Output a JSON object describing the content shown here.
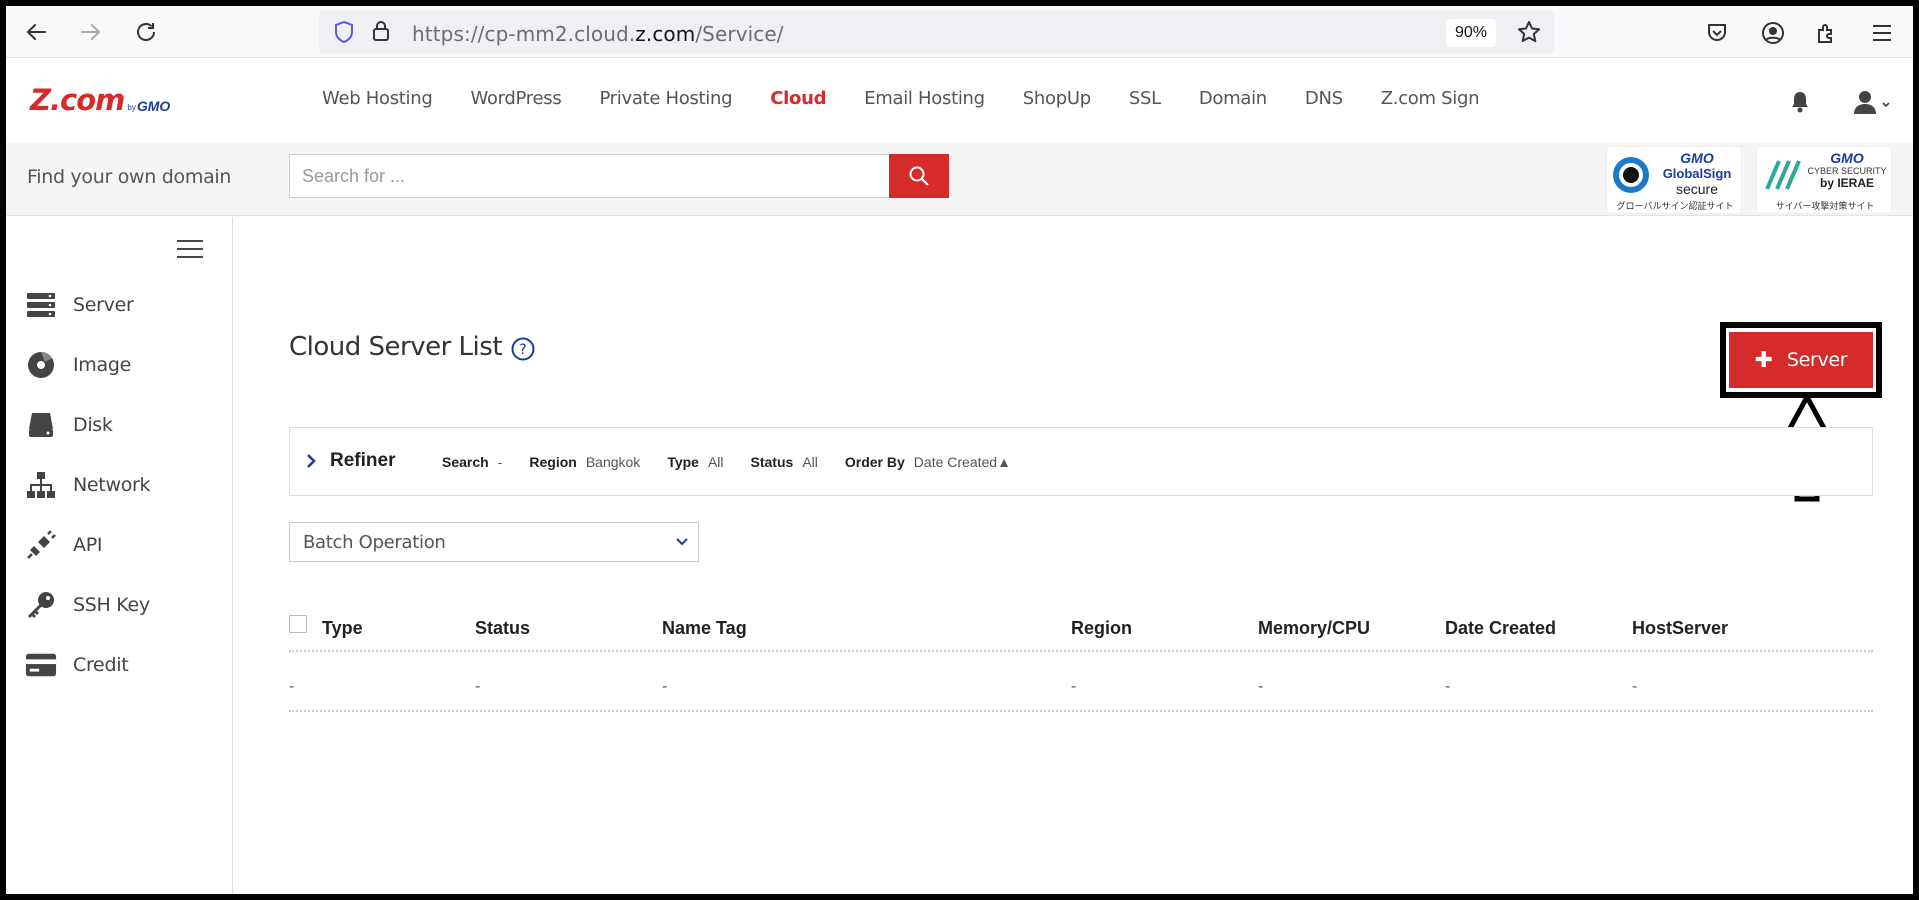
{
  "browser": {
    "url_prefix": "https://cp-mm2.cloud.",
    "url_host": "z.com",
    "url_path": "/Service/",
    "zoom": "90%"
  },
  "header": {
    "logo_text": "Z.com",
    "logo_by": "by",
    "logo_gmo": "GMO",
    "nav": [
      {
        "label": "Web Hosting"
      },
      {
        "label": "WordPress"
      },
      {
        "label": "Private Hosting"
      },
      {
        "label": "Cloud",
        "active": true
      },
      {
        "label": "Email Hosting"
      },
      {
        "label": "ShopUp"
      },
      {
        "label": "SSL"
      },
      {
        "label": "Domain"
      },
      {
        "label": "DNS"
      },
      {
        "label": "Z.com Sign"
      }
    ]
  },
  "domain_search": {
    "label": "Find your own domain",
    "placeholder": "Search for ..."
  },
  "badges": {
    "globalsign": {
      "l1": "GMO",
      "l2": "GlobalSign",
      "l3": "secure",
      "jp": "グローバルサイン認証サイト"
    },
    "ierae": {
      "l1": "GMO",
      "l2": "CYBER SECURITY",
      "l3": "by IERAE",
      "jp": "サイバー攻撃対策サイト"
    }
  },
  "sidebar": {
    "items": [
      {
        "label": "Server",
        "icon": "server-icon"
      },
      {
        "label": "Image",
        "icon": "disc-icon"
      },
      {
        "label": "Disk",
        "icon": "disk-icon"
      },
      {
        "label": "Network",
        "icon": "network-icon"
      },
      {
        "label": "API",
        "icon": "plug-icon"
      },
      {
        "label": "SSH Key",
        "icon": "key-icon"
      },
      {
        "label": "Credit",
        "icon": "credit-card-icon"
      }
    ]
  },
  "main": {
    "title": "Cloud Server List",
    "add_button": "Server",
    "refiner": {
      "title": "Refiner",
      "filters": [
        {
          "key": "Search",
          "value": "-"
        },
        {
          "key": "Region",
          "value": "Bangkok"
        },
        {
          "key": "Type",
          "value": "All"
        },
        {
          "key": "Status",
          "value": "All"
        },
        {
          "key": "Order By",
          "value": "Date Created▲"
        }
      ]
    },
    "batch_operation": "Batch Operation",
    "table": {
      "columns": [
        "Type",
        "Status",
        "Name Tag",
        "Region",
        "Memory/CPU",
        "Date Created",
        "HostServer"
      ],
      "rows": [
        [
          "-",
          "-",
          "-",
          "-",
          "-",
          "-",
          "-"
        ]
      ]
    }
  },
  "colors": {
    "brand_red": "#d52b2b",
    "brand_blue": "#1a3d9c"
  }
}
